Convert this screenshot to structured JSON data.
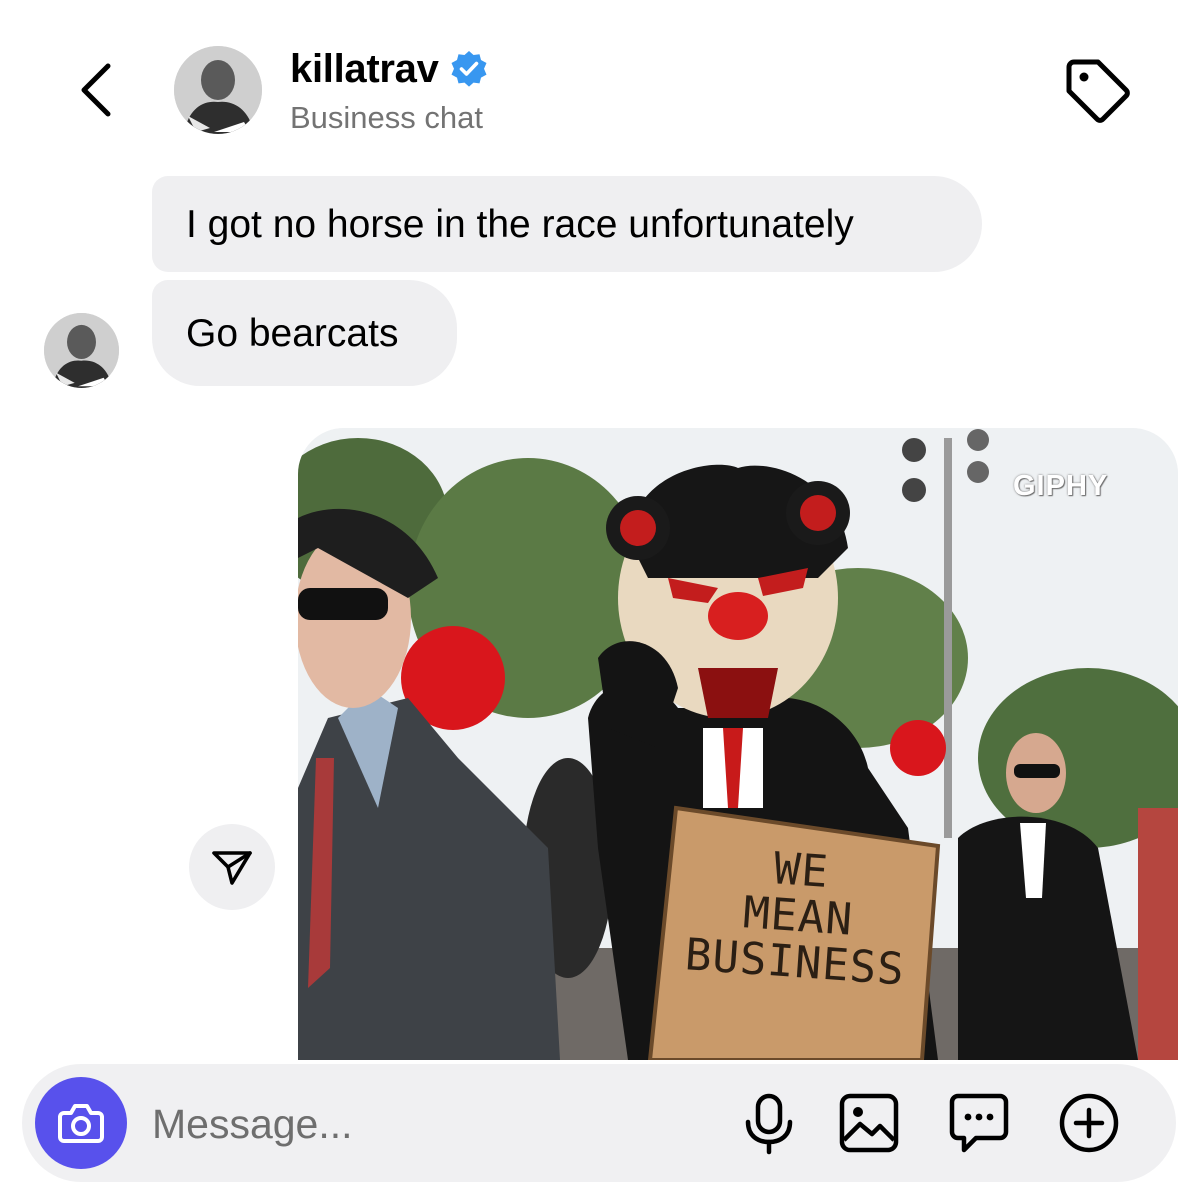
{
  "header": {
    "username": "killatrav",
    "subtitle": "Business chat",
    "back_icon": "chevron-left-icon",
    "verified_icon": "verified-badge-icon",
    "tag_icon": "tag-icon",
    "verified_color": "#3897f0"
  },
  "messages": [
    {
      "sender": "killatrav",
      "text": "I got no horse in the race unfortunately"
    },
    {
      "sender": "killatrav",
      "text": "Go bearcats"
    }
  ],
  "gif": {
    "watermark": "GIPHY",
    "sign_text": "WE MEAN BUSINESS",
    "share_icon": "share-paper-plane-icon"
  },
  "composer": {
    "placeholder": "Message...",
    "camera_icon": "camera-icon",
    "mic_icon": "microphone-icon",
    "gallery_icon": "image-gallery-icon",
    "sticker_icon": "chat-bubble-icon",
    "plus_icon": "plus-circle-icon",
    "camera_color": "#5851ec"
  }
}
